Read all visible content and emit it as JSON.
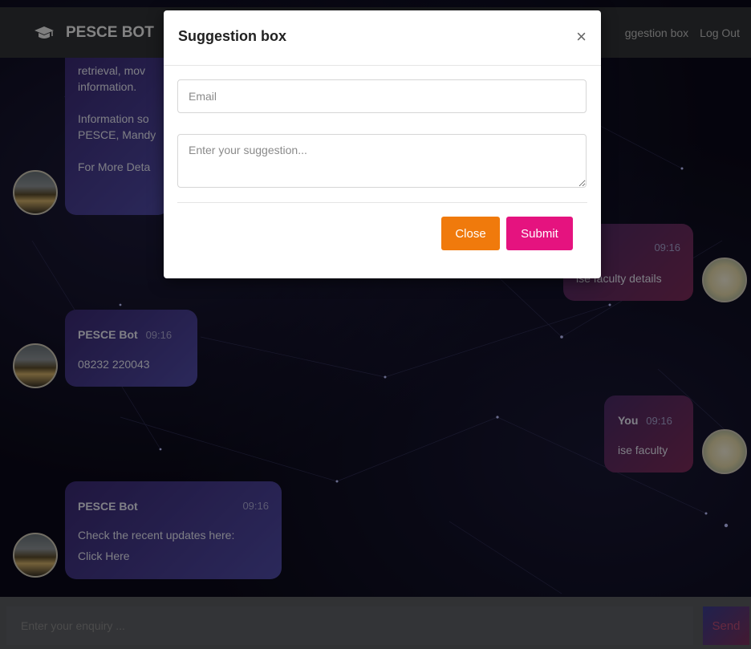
{
  "navbar": {
    "brand": "PESCE BOT",
    "links": [
      "ggestion box",
      "Log Out"
    ]
  },
  "messages": {
    "first_bot": {
      "lines": [
        "retrieval, mov",
        "information.",
        "Information so",
        "PESCE, Mandy",
        "For More Deta"
      ]
    },
    "user1": {
      "time": "09:16",
      "text": "ise faculty details"
    },
    "bot2": {
      "sender": "PESCE Bot",
      "time": "09:16",
      "text": "08232 220043"
    },
    "user2": {
      "sender": "You",
      "time": "09:16",
      "text": "ise faculty"
    },
    "bot3": {
      "sender": "PESCE Bot",
      "time": "09:16",
      "text": "Check the recent updates here:",
      "link": "Click Here"
    }
  },
  "modal": {
    "title": "Suggestion box",
    "close_symbol": "×",
    "email_placeholder": "Email",
    "suggestion_placeholder": "Enter your suggestion...",
    "close_label": "Close",
    "submit_label": "Submit"
  },
  "footer": {
    "enquiry_placeholder": "Enter your enquiry ...",
    "send_label": "Send"
  },
  "colors": {
    "navbar": "#303236",
    "close_button": "#f07a0c",
    "submit_button": "#e5137f",
    "bot_bubble": "#4f4aa5",
    "user_bubble": "#7b2a58"
  },
  "icons": [
    "graduation-cap-icon",
    "close-icon",
    "bot-avatar",
    "user-avatar"
  ]
}
